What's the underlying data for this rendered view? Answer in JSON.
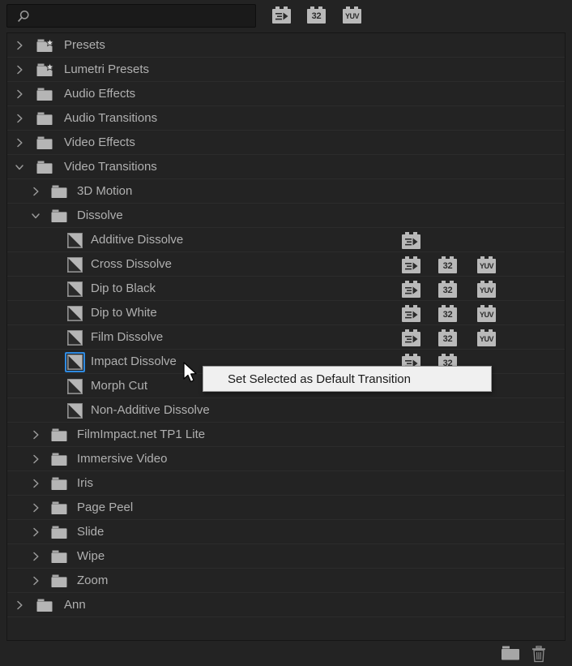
{
  "panel": {
    "name": "effects-panel",
    "background": "#232323",
    "text_color": "#b0b0b0",
    "selection_color": "#2f8ae0"
  },
  "search": {
    "value": "",
    "placeholder": "",
    "icon": "search-icon"
  },
  "toolbar_filters": [
    {
      "icon": "accelerated-effects-icon",
      "label": ""
    },
    {
      "icon": "32-bit-color-icon",
      "label": "32"
    },
    {
      "icon": "yuv-color-icon",
      "label": "YUV"
    }
  ],
  "tree": [
    {
      "label": "Presets",
      "type": "preset-folder",
      "depth": 0,
      "expanded": false,
      "badges": []
    },
    {
      "label": "Lumetri Presets",
      "type": "preset-folder",
      "depth": 0,
      "expanded": false,
      "badges": []
    },
    {
      "label": "Audio Effects",
      "type": "folder",
      "depth": 0,
      "expanded": false,
      "badges": []
    },
    {
      "label": "Audio Transitions",
      "type": "folder",
      "depth": 0,
      "expanded": false,
      "badges": []
    },
    {
      "label": "Video Effects",
      "type": "folder",
      "depth": 0,
      "expanded": false,
      "badges": []
    },
    {
      "label": "Video Transitions",
      "type": "folder",
      "depth": 0,
      "expanded": true,
      "badges": []
    },
    {
      "label": "3D Motion",
      "type": "folder",
      "depth": 1,
      "expanded": false,
      "badges": []
    },
    {
      "label": "Dissolve",
      "type": "folder",
      "depth": 1,
      "expanded": true,
      "badges": []
    },
    {
      "label": "Additive Dissolve",
      "type": "transition",
      "depth": 2,
      "selected": false,
      "badges": [
        "accel"
      ]
    },
    {
      "label": "Cross Dissolve",
      "type": "transition",
      "depth": 2,
      "selected": false,
      "badges": [
        "accel",
        "32",
        "YUV"
      ]
    },
    {
      "label": "Dip to Black",
      "type": "transition",
      "depth": 2,
      "selected": false,
      "badges": [
        "accel",
        "32",
        "YUV"
      ]
    },
    {
      "label": "Dip to White",
      "type": "transition",
      "depth": 2,
      "selected": false,
      "badges": [
        "accel",
        "32",
        "YUV"
      ]
    },
    {
      "label": "Film Dissolve",
      "type": "transition",
      "depth": 2,
      "selected": false,
      "badges": [
        "accel",
        "32",
        "YUV"
      ]
    },
    {
      "label": "Impact Dissolve",
      "type": "transition",
      "depth": 2,
      "selected": true,
      "badges": [
        "accel",
        "32"
      ]
    },
    {
      "label": "Morph Cut",
      "type": "transition",
      "depth": 2,
      "selected": false,
      "badges": []
    },
    {
      "label": "Non-Additive Dissolve",
      "type": "transition",
      "depth": 2,
      "selected": false,
      "badges": []
    },
    {
      "label": "FilmImpact.net TP1 Lite",
      "type": "folder",
      "depth": 1,
      "expanded": false,
      "badges": []
    },
    {
      "label": "Immersive Video",
      "type": "folder",
      "depth": 1,
      "expanded": false,
      "badges": []
    },
    {
      "label": "Iris",
      "type": "folder",
      "depth": 1,
      "expanded": false,
      "badges": []
    },
    {
      "label": "Page Peel",
      "type": "folder",
      "depth": 1,
      "expanded": false,
      "badges": []
    },
    {
      "label": "Slide",
      "type": "folder",
      "depth": 1,
      "expanded": false,
      "badges": []
    },
    {
      "label": "Wipe",
      "type": "folder",
      "depth": 1,
      "expanded": false,
      "badges": []
    },
    {
      "label": "Zoom",
      "type": "folder",
      "depth": 1,
      "expanded": false,
      "badges": []
    },
    {
      "label": "Ann",
      "type": "folder",
      "depth": 0,
      "expanded": false,
      "badges": []
    }
  ],
  "context_menu": {
    "items": [
      {
        "label": "Set Selected as Default Transition"
      }
    ]
  },
  "footer": {
    "buttons": [
      {
        "icon": "new-custom-bin-icon"
      },
      {
        "icon": "delete-icon"
      }
    ]
  },
  "cursor": {
    "icon": "arrow-cursor"
  }
}
